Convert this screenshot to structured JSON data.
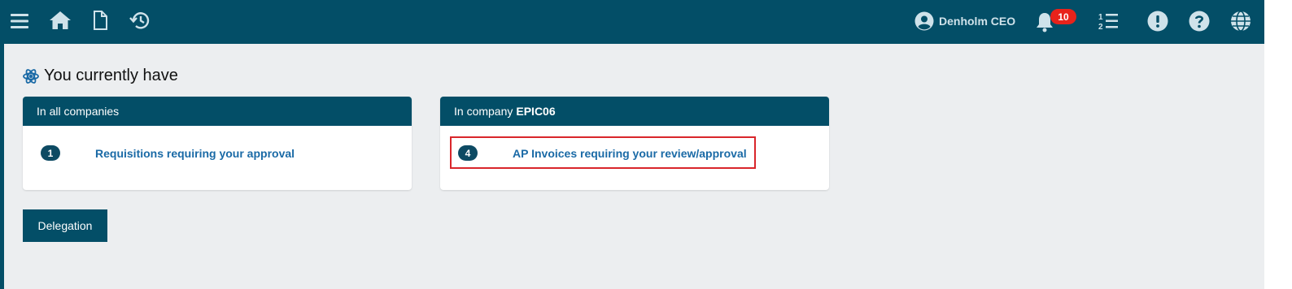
{
  "topbar": {
    "icons": [
      "menu-icon",
      "home-icon",
      "document-icon",
      "history-icon"
    ],
    "user_name": "Denholm CEO",
    "notification_count": "10",
    "right_icons": [
      "notification-bell-icon",
      "numbered-list-icon",
      "alert-icon",
      "help-icon",
      "globe-icon"
    ]
  },
  "main": {
    "heading": "You currently have",
    "cards": [
      {
        "header": "In all companies",
        "header_strong": "",
        "count": "1",
        "link": "Requisitions requiring your approval"
      },
      {
        "header": "In company",
        "header_strong": "EPIC06",
        "count": "4",
        "link": "AP Invoices requiring your review/approval"
      }
    ],
    "delegation_label": "Delegation"
  },
  "colors": {
    "brand": "#034e67",
    "link": "#1a6aa6",
    "badge": "#e8231b",
    "highlight": "#d9262b"
  }
}
